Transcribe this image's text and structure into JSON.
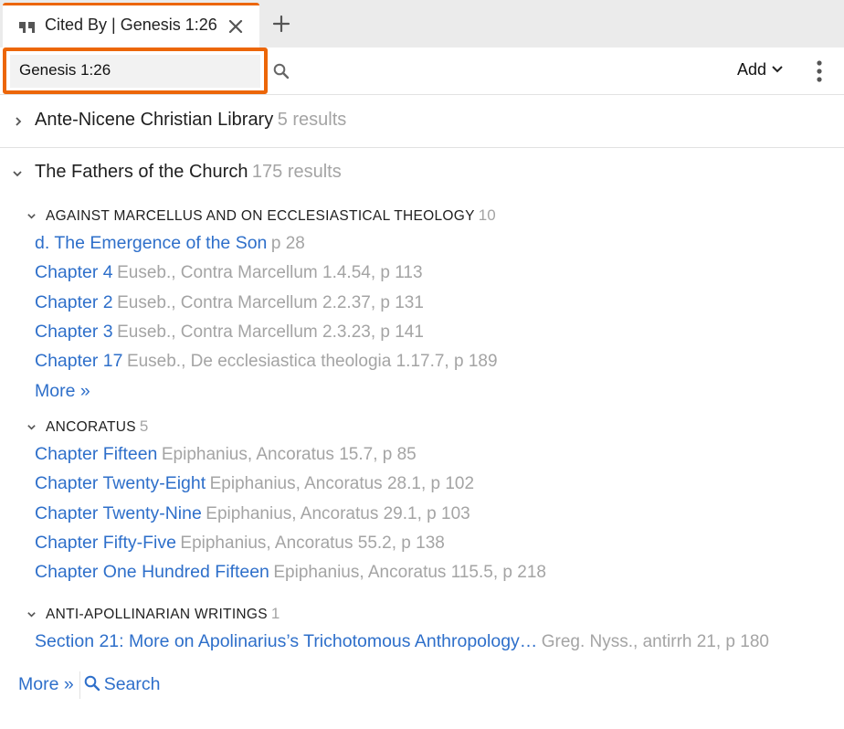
{
  "tab": {
    "title": "Cited By | Genesis 1:26",
    "icon": "quote-icon"
  },
  "search": {
    "value": "Genesis 1:26"
  },
  "toolbar": {
    "add_label": "Add"
  },
  "collections": [
    {
      "title": "Ante-Nicene Christian Library",
      "count": "5 results",
      "expanded": false
    },
    {
      "title": "The Fathers of the Church",
      "count": "175 results",
      "expanded": true,
      "groups": [
        {
          "title": "AGAINST MARCELLUS AND ON ECCLESIASTICAL THEOLOGY",
          "count": "10",
          "items": [
            {
              "link": "d. The Emergence of the Son",
              "meta": "p 28"
            },
            {
              "link": "Chapter 4",
              "meta": "Euseb., Contra Marcellum 1.4.54, p 113"
            },
            {
              "link": "Chapter 2",
              "meta": "Euseb., Contra Marcellum 2.2.37, p 131"
            },
            {
              "link": "Chapter 3",
              "meta": "Euseb., Contra Marcellum 2.3.23, p 141"
            },
            {
              "link": "Chapter 17",
              "meta": "Euseb., De ecclesiastica theologia 1.17.7, p 189"
            }
          ],
          "more": "More »"
        },
        {
          "title": "ANCORATUS",
          "count": "5",
          "items": [
            {
              "link": "Chapter Fifteen",
              "meta": "Epiphanius, Ancoratus 15.7, p 85"
            },
            {
              "link": "Chapter Twenty-Eight",
              "meta": "Epiphanius, Ancoratus 28.1, p 102"
            },
            {
              "link": "Chapter Twenty-Nine",
              "meta": "Epiphanius, Ancoratus 29.1, p 103"
            },
            {
              "link": "Chapter Fifty-Five",
              "meta": "Epiphanius, Ancoratus 55.2, p 138"
            },
            {
              "link": "Chapter One Hundred Fifteen",
              "meta": "Epiphanius, Ancoratus 115.5, p 218"
            }
          ]
        },
        {
          "title": "ANTI-APOLLINARIAN WRITINGS",
          "count": "1",
          "items": [
            {
              "link": "Section 21: More on Apolinarius’s Trichotomous Anthropology…",
              "meta": "Greg. Nyss., antirrh 21, p 180"
            }
          ]
        }
      ]
    }
  ],
  "footer": {
    "more": "More »",
    "search": "Search"
  },
  "colors": {
    "accent": "#ec6608",
    "link": "#2e6fca",
    "muted": "#a4a4a4"
  }
}
